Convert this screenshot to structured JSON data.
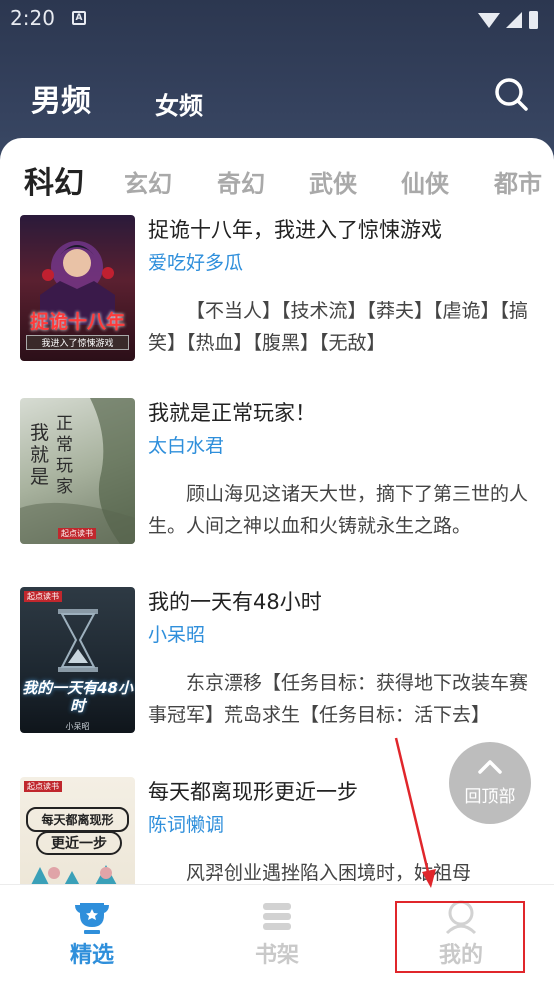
{
  "status_bar": {
    "time": "2:20",
    "notification_badge": "A"
  },
  "header": {
    "tabs": [
      {
        "label": "男频",
        "active": true
      },
      {
        "label": "女频",
        "active": false
      }
    ],
    "search_icon": "search-icon"
  },
  "categories": [
    {
      "label": "科幻",
      "active": true
    },
    {
      "label": "玄幻",
      "active": false
    },
    {
      "label": "奇幻",
      "active": false
    },
    {
      "label": "武侠",
      "active": false
    },
    {
      "label": "仙侠",
      "active": false
    },
    {
      "label": "都市",
      "active": false
    }
  ],
  "books": [
    {
      "title": "捉诡十八年，我进入了惊悚游戏",
      "author": "爱吃好多瓜",
      "desc": "【不当人】【技术流】【莽夫】【虐诡】【搞笑】【热血】【腹黑】【无敌】",
      "cover_text": [
        "捉诡十八年",
        "我进入了惊悚游戏"
      ]
    },
    {
      "title": "我就是正常玩家！",
      "author": "太白水君",
      "desc": "顾山海见这诸天大世，摘下了第三世的人生。人间之神以血和火铸就永生之路。",
      "cover_text": [
        "我就是",
        "正常玩家",
        "起点读书"
      ]
    },
    {
      "title": "我的一天有48小时",
      "author": "小呆昭",
      "desc": "东京漂移【任务目标：获得地下改装车赛事冠军】荒岛求生【任务目标：活下去】",
      "cover_text": [
        "起点读书",
        "我的一天有48小时",
        "小呆昭"
      ]
    },
    {
      "title": "每天都离现形更近一步",
      "author": "陈词懒调",
      "desc": "风羿创业遇挫陷入困境时，姑祖母",
      "cover_text": [
        "起点读书",
        "每天都离现形",
        "更近一步"
      ]
    }
  ],
  "back_to_top": {
    "label": "回顶部"
  },
  "bottom_nav": [
    {
      "label": "精选",
      "icon": "trophy-icon",
      "active": true
    },
    {
      "label": "书架",
      "icon": "bookshelf-icon",
      "active": false
    },
    {
      "label": "我的",
      "icon": "user-icon",
      "active": false
    }
  ],
  "colors": {
    "header_bg": "#35425e",
    "accent": "#2f8fdb",
    "author": "#2f8fdb",
    "inactive": "#c9c9c9",
    "annotation": "#e0262b"
  }
}
